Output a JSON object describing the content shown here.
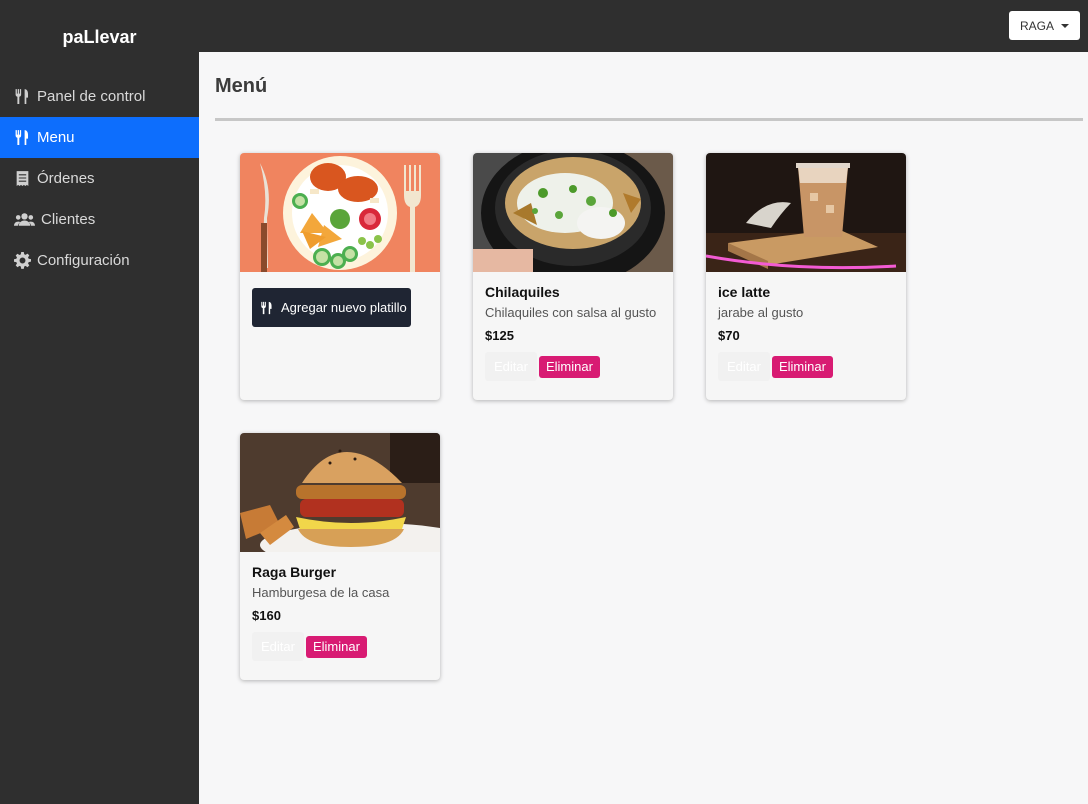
{
  "app": {
    "brand": "paLlevar"
  },
  "header": {
    "user_label": "RAGA"
  },
  "sidebar": {
    "items": [
      {
        "label": "Panel de control",
        "icon": "utensils-icon",
        "active": false
      },
      {
        "label": "Menu",
        "icon": "utensils-icon",
        "active": true
      },
      {
        "label": "Órdenes",
        "icon": "receipt-icon",
        "active": false
      },
      {
        "label": "Clientes",
        "icon": "users-icon",
        "active": false
      },
      {
        "label": "Configuración",
        "icon": "gear-icon",
        "active": false
      }
    ]
  },
  "main": {
    "title": "Menú",
    "add_button_label": "Agregar nuevo platillo",
    "dishes": [
      {
        "name": "Chilaquiles",
        "description": "Chilaquiles con salsa al gusto",
        "price": "$125",
        "edit_label": "Editar",
        "delete_label": "Eliminar"
      },
      {
        "name": "ice latte",
        "description": "jarabe al gusto",
        "price": "$70",
        "edit_label": "Editar",
        "delete_label": "Eliminar"
      },
      {
        "name": "Raga Burger",
        "description": "Hamburgesa de la casa",
        "price": "$160",
        "edit_label": "Editar",
        "delete_label": "Eliminar"
      }
    ]
  },
  "colors": {
    "sidebar_bg": "#2f2f2f",
    "active_nav": "#0d6efd",
    "delete_button": "#d81b73",
    "add_button": "#1f2533"
  }
}
